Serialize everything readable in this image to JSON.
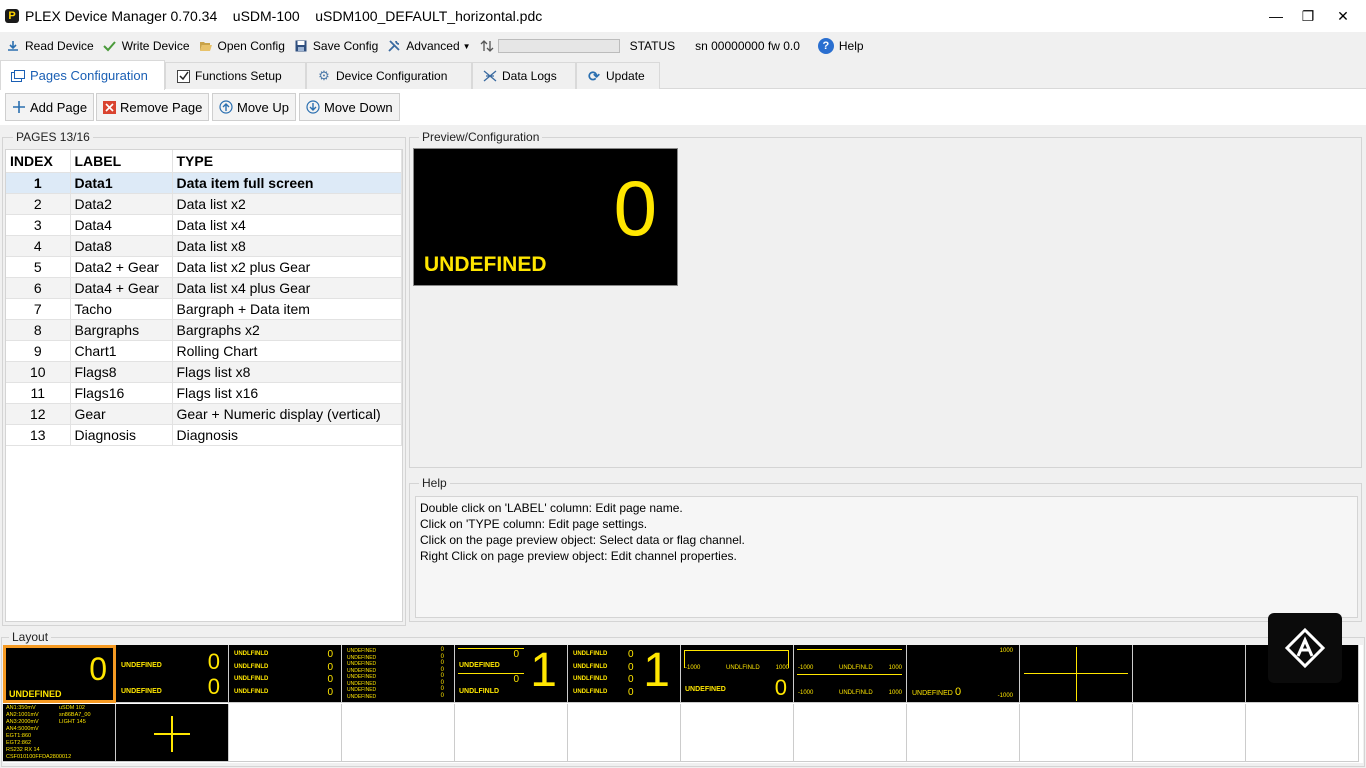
{
  "window": {
    "title": "PLEX Device Manager 0.70.34    uSDM-100    uSDM100_DEFAULT_horizontal.pdc",
    "logo_letter": "P",
    "controls": {
      "minimize": "—",
      "restore": "❐",
      "close": "✕"
    }
  },
  "toolbar": {
    "read_device": "Read Device",
    "write_device": "Write Device",
    "open_config": "Open Config",
    "save_config": "Save Config",
    "advanced": "Advanced",
    "status_label": "STATUS",
    "serial": "sn 00000000 fw 0.0",
    "help": "Help"
  },
  "tabs": [
    {
      "label": "Pages Configuration",
      "active": true
    },
    {
      "label": "Functions Setup"
    },
    {
      "label": "Device Configuration"
    },
    {
      "label": "Data Logs"
    },
    {
      "label": "Update"
    }
  ],
  "page_actions": {
    "add": "Add Page",
    "remove": "Remove Page",
    "up": "Move Up",
    "down": "Move Down"
  },
  "pages_group": {
    "title": "PAGES 13/16",
    "columns": [
      "INDEX",
      "LABEL",
      "TYPE"
    ],
    "rows": [
      [
        "1",
        "Data1",
        "Data item full screen"
      ],
      [
        "2",
        "Data2",
        "Data list x2"
      ],
      [
        "3",
        "Data4",
        "Data list x4"
      ],
      [
        "4",
        "Data8",
        "Data list x8"
      ],
      [
        "5",
        "Data2 + Gear",
        "Data list x2 plus Gear"
      ],
      [
        "6",
        "Data4 + Gear",
        "Data list x4 plus Gear"
      ],
      [
        "7",
        "Tacho",
        "Bargraph + Data item"
      ],
      [
        "8",
        "Bargraphs",
        "Bargraphs x2"
      ],
      [
        "9",
        "Chart1",
        "Rolling Chart"
      ],
      [
        "10",
        "Flags8",
        "Flags list x8"
      ],
      [
        "11",
        "Flags16",
        "Flags list x16"
      ],
      [
        "12",
        "Gear",
        "Gear + Numeric display (vertical)"
      ],
      [
        "13",
        "Diagnosis",
        "Diagnosis"
      ]
    ]
  },
  "preview": {
    "title": "Preview/Configuration",
    "value": "0",
    "label": "UNDEFINED"
  },
  "help": {
    "title": "Help",
    "lines": [
      "Double click on 'LABEL' column: Edit page name.",
      "Click on 'TYPE column: Edit page settings.",
      "Click on the page preview object: Select data or flag channel.",
      "Right Click on page preview object: Edit channel properties."
    ]
  },
  "layout": {
    "title": "Layout",
    "undefined": "UNDEFINED",
    "undefined_short": "UNDLFINLD",
    "zero": "0",
    "one": "1",
    "scale_min": "-1000",
    "scale_max": "1000",
    "diagnosis": {
      "left": [
        "AN1:350mV",
        "AN2:1001mV",
        "AN3:2000mV",
        "AN4:5000mV",
        "EGT1:860",
        "EGT2:862",
        "RS232 RX 14",
        "CSF010100FFDA2800012"
      ],
      "right": [
        "uSDM 102",
        "sn86BA7_00",
        "LIGHT 145"
      ]
    }
  },
  "colors": {
    "accent": "#1a5fb4",
    "display_yellow": "#ffe600",
    "selection": "#f59a23"
  }
}
